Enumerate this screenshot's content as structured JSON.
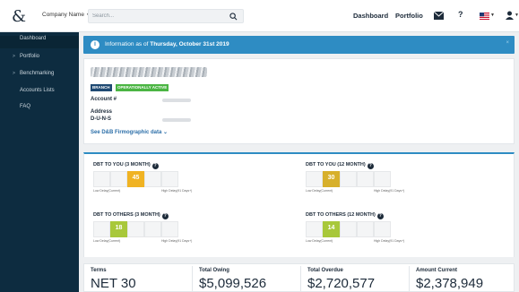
{
  "header": {
    "company_selector": "Company Name",
    "search_placeholder": "Search...",
    "nav": [
      "Dashboard",
      "Portfolio"
    ],
    "help": "?"
  },
  "sidebar": {
    "items": [
      {
        "label": "Dashboard",
        "arrow": ""
      },
      {
        "label": "Portfolio",
        "arrow": ">"
      },
      {
        "label": "Benchmarking",
        "arrow": ">"
      },
      {
        "label": "Accounts Lists",
        "arrow": ""
      },
      {
        "label": "FAQ",
        "arrow": ""
      }
    ]
  },
  "banner": {
    "prefix": "Information as of ",
    "date": "Thursday, October 31st 2019"
  },
  "company": {
    "badges": [
      "BRANCH",
      "OPERATIONALLY ACTIVE"
    ],
    "fields": [
      "Account #",
      "Address",
      "D-U-N-S"
    ],
    "see_more": "See D&B Firmographic data"
  },
  "dbt": [
    {
      "title": "DBT TO YOU (3 MONTH)",
      "value": "45",
      "highlight_index": 2,
      "color": "#f0b323",
      "low": "Low Delay(Current)",
      "high": "High Delay(91 Days+)"
    },
    {
      "title": "DBT TO YOU (12 MONTH)",
      "value": "30",
      "highlight_index": 1,
      "color": "#d7b02b",
      "low": "Low Delay(Current)",
      "high": "High Delay(91 Days+)"
    },
    {
      "title": "DBT TO OTHERS (3 MONTH)",
      "value": "18",
      "highlight_index": 1,
      "color": "#a8c83a",
      "low": "Low Delay(Current)",
      "high": "High Delay(91 Days+)"
    },
    {
      "title": "DBT TO OTHERS (12 MONTH)",
      "value": "14",
      "highlight_index": 1,
      "color": "#a8c83a",
      "low": "Low Delay(Current)",
      "high": "High Delay(91 Days+)"
    }
  ],
  "stats": [
    {
      "label": "Terms",
      "value": "NET 30"
    },
    {
      "label": "Total Owing",
      "value": "$5,099,526"
    },
    {
      "label": "Total Overdue",
      "value": "$2,720,577"
    },
    {
      "label": "Amount Current",
      "value": "$2,378,949"
    }
  ]
}
